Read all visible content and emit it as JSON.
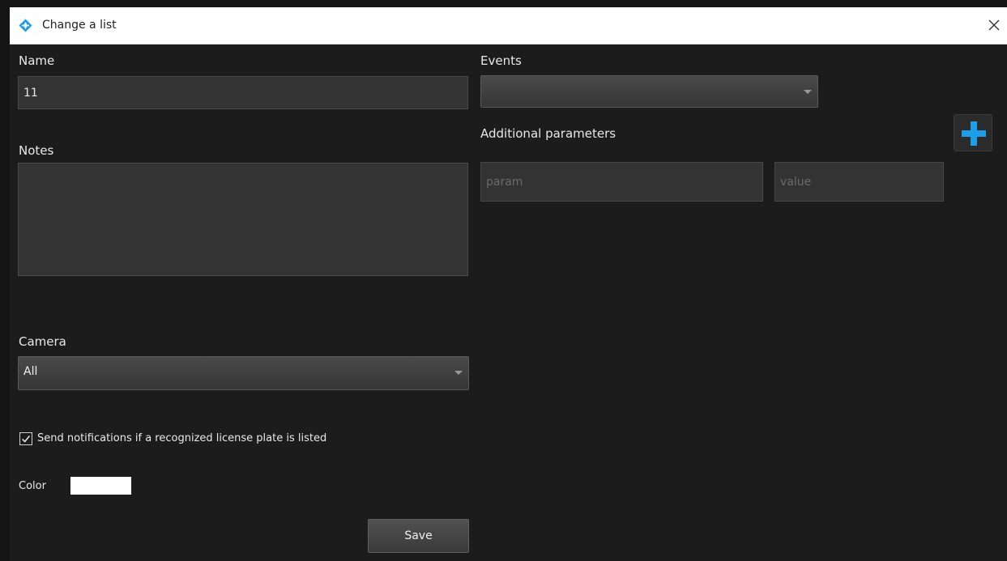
{
  "window": {
    "title": "Change a list"
  },
  "form": {
    "name_label": "Name",
    "name_value": "11",
    "notes_label": "Notes",
    "notes_value": "",
    "camera_label": "Camera",
    "camera_value": "All",
    "notify_label": "Send notifications if a recognized license plate is listed",
    "notify_checked": true,
    "color_label": "Color",
    "color_value": "#ffffff",
    "save_label": "Save"
  },
  "events": {
    "label": "Events",
    "value": ""
  },
  "additional": {
    "label": "Additional parameters",
    "param_placeholder": "param",
    "value_placeholder": "value"
  },
  "icons": {
    "app": "app-diamond-icon",
    "close": "close-icon",
    "add": "plus-icon",
    "check": "checkmark-icon",
    "dropdown": "chevron-down-icon"
  },
  "colors": {
    "accent": "#1e9ee8",
    "background": "#1c1c1c",
    "field": "#333333"
  }
}
